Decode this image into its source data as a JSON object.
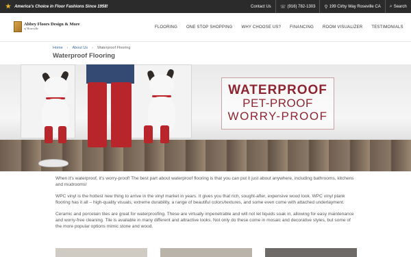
{
  "topbar": {
    "tagline": "America's Choice in Floor Fashions Since 1958!",
    "contact_us": "Contact Us",
    "phone": "(916) 782-1303",
    "address": "199 Cirby Way Roseville CA",
    "search": "Search"
  },
  "logo": {
    "title": "Abbey Floors Design & More",
    "subtitle": "of Roseville"
  },
  "nav": {
    "items": [
      "FLOORING",
      "ONE STOP SHOPPING",
      "WHY CHOOSE US?",
      "FINANCING",
      "ROOM VISUALIZER",
      "TESTIMONIALS"
    ]
  },
  "breadcrumb": {
    "home": "Home",
    "about": "About Us",
    "current": "Waterproof Flooring"
  },
  "page_title": "Waterproof Flooring",
  "hero": {
    "line1": "WATERPROOF",
    "line2": "PET-PROOF",
    "line3": "WORRY-PROOF"
  },
  "content": {
    "p1": "When it's waterproof, it's worry-proof! The best part about waterproof flooring is that you can put it just about anywhere, including bathrooms, kitchens and mudrooms!",
    "p2": "WPC vinyl is the hottest new thing to arrive in the vinyl market in years. It gives you that rich, sought-after, expensive wood look. WPC vinyl plank flooring has it all – high-quality visuals, extreme durability, a range of beautiful colors/textures, and some even come with attached underlayment.",
    "p3": "Ceramic and porcelain tiles are great for waterproofing. These are virtually impenetrable and will not let liquids soak in, allowing for easy maintenance and worry-free cleaning. Tile is available in many different and attractive looks. Not only do these come in mosaic and decorative styles, but some of the more popular options mimic stone and wood."
  },
  "colors": {
    "topbar_bg": "#2b2b2b",
    "accent_star": "#e7b52c",
    "hero_text": "#8e2430",
    "link": "#3a6aa0"
  }
}
